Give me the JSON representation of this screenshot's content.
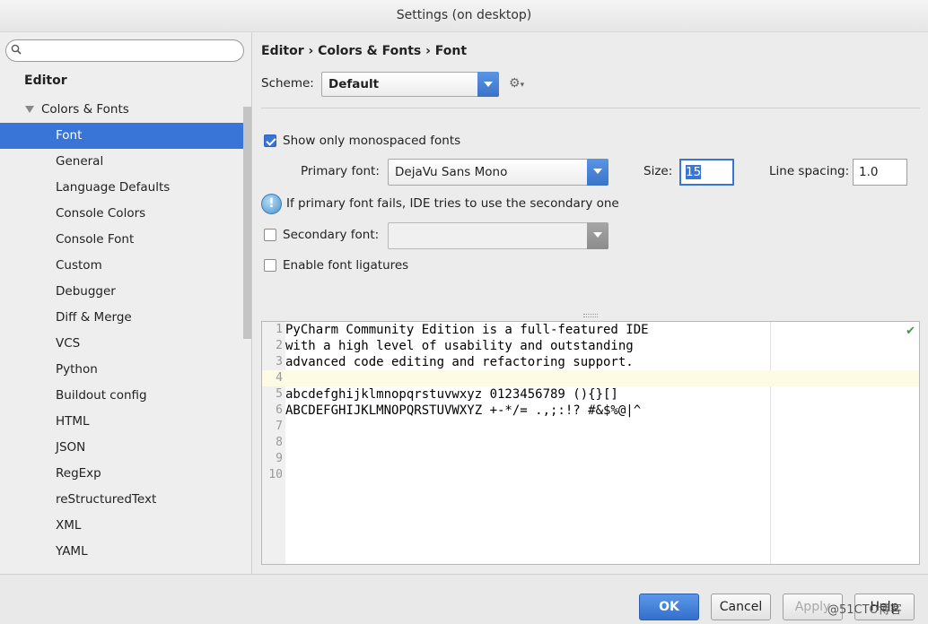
{
  "window": {
    "title": "Settings (on desktop)"
  },
  "sidebar": {
    "search_placeholder": "",
    "section_title": "Editor",
    "group_label": "Colors & Fonts",
    "items": [
      {
        "label": "Font",
        "selected": true
      },
      {
        "label": "General"
      },
      {
        "label": "Language Defaults"
      },
      {
        "label": "Console Colors"
      },
      {
        "label": "Console Font"
      },
      {
        "label": "Custom"
      },
      {
        "label": "Debugger"
      },
      {
        "label": "Diff & Merge"
      },
      {
        "label": "VCS"
      },
      {
        "label": "Python"
      },
      {
        "label": "Buildout config"
      },
      {
        "label": "HTML"
      },
      {
        "label": "JSON"
      },
      {
        "label": "RegExp"
      },
      {
        "label": "reStructuredText"
      },
      {
        "label": "XML"
      },
      {
        "label": "YAML"
      }
    ]
  },
  "main": {
    "breadcrumb": "Editor › Colors & Fonts › Font",
    "scheme_label": "Scheme:",
    "scheme_value": "Default",
    "show_monospaced_label": "Show only monospaced fonts",
    "show_monospaced_checked": true,
    "primary_font_label": "Primary font:",
    "primary_font_value": "DejaVu Sans Mono",
    "size_label": "Size:",
    "size_value": "15",
    "line_spacing_label": "Line spacing:",
    "line_spacing_value": "1.0",
    "info_text": "If primary font fails, IDE tries to use the secondary one",
    "secondary_font_label": "Secondary font:",
    "secondary_font_checked": false,
    "secondary_font_value": "",
    "ligatures_label": "Enable font ligatures",
    "ligatures_checked": false
  },
  "preview": {
    "lines": [
      {
        "num": "1",
        "text": "PyCharm Community Edition is a full-featured IDE"
      },
      {
        "num": "2",
        "text": "with a high level of usability and outstanding"
      },
      {
        "num": "3",
        "text": "advanced code editing and refactoring support."
      },
      {
        "num": "4",
        "text": ""
      },
      {
        "num": "5",
        "text": "abcdefghijklmnopqrstuvwxyz 0123456789 (){}[]"
      },
      {
        "num": "6",
        "text": "ABCDEFGHIJKLMNOPQRSTUVWXYZ +-*/= .,;:!? #&$%@|^"
      },
      {
        "num": "7",
        "text": ""
      },
      {
        "num": "8",
        "text": ""
      },
      {
        "num": "9",
        "text": ""
      },
      {
        "num": "10",
        "text": ""
      }
    ],
    "current_line": "4",
    "status_mark": "✔"
  },
  "footer": {
    "ok_label": "OK",
    "cancel_label": "Cancel",
    "apply_label": "Apply",
    "help_label": "Help",
    "watermark": "@51CTO博客"
  },
  "colors": {
    "accent": "#3875d7",
    "current_line": "#fdfbe4"
  }
}
